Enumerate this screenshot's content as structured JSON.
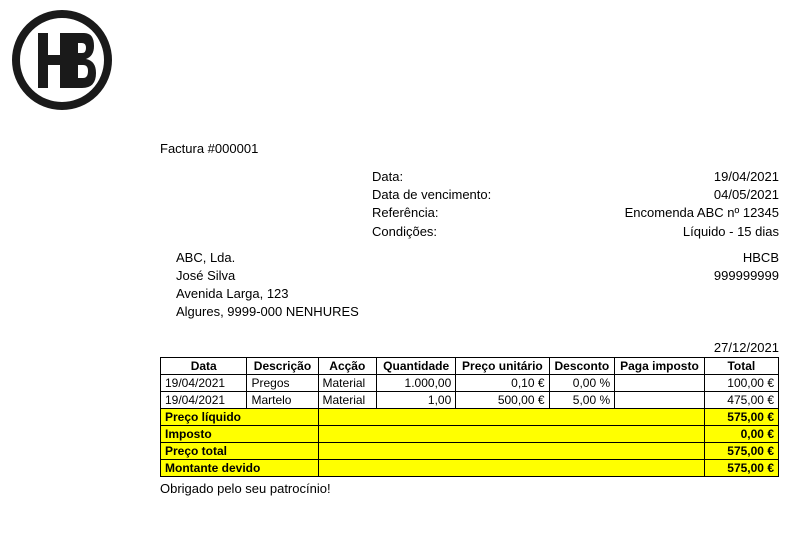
{
  "invoice_title": "Factura #000001",
  "meta": {
    "date_label": "Data:",
    "date_value": "19/04/2021",
    "due_label": "Data de vencimento:",
    "due_value": "04/05/2021",
    "ref_label": "Referência:",
    "ref_value": "Encomenda ABC nº 12345",
    "terms_label": "Condições:",
    "terms_value": "Líquido - 15 dias"
  },
  "customer": {
    "company": "ABC, Lda.",
    "contact": "José Silva",
    "street": "Avenida Larga, 123",
    "city": "Algures, 9999-000 NENHURES"
  },
  "issuer": {
    "name": "HBCB",
    "id": "999999999"
  },
  "print_date": "27/12/2021",
  "columns": {
    "data": "Data",
    "descricao": "Descrição",
    "accao": "Acção",
    "quantidade": "Quantidade",
    "preco_unitario": "Preço unitário",
    "desconto": "Desconto",
    "paga_imposto": "Paga imposto",
    "total": "Total"
  },
  "lines": [
    {
      "data": "19/04/2021",
      "descricao": "Pregos",
      "accao": "Material",
      "quantidade": "1.000,00",
      "preco_unitario": "0,10 €",
      "desconto": "0,00 %",
      "paga_imposto": "",
      "total": "100,00 €"
    },
    {
      "data": "19/04/2021",
      "descricao": "Martelo",
      "accao": "Material",
      "quantidade": "1,00",
      "preco_unitario": "500,00 €",
      "desconto": "5,00 %",
      "paga_imposto": "",
      "total": "475,00 €"
    }
  ],
  "summary": {
    "net_label": "Preço líquido",
    "net_value": "575,00 €",
    "tax_label": "Imposto",
    "tax_value": "0,00 €",
    "total_label": "Preço total",
    "total_value": "575,00 €",
    "due_label": "Montante devido",
    "due_value": "575,00 €"
  },
  "footer_note": "Obrigado pelo seu patrocínio!"
}
